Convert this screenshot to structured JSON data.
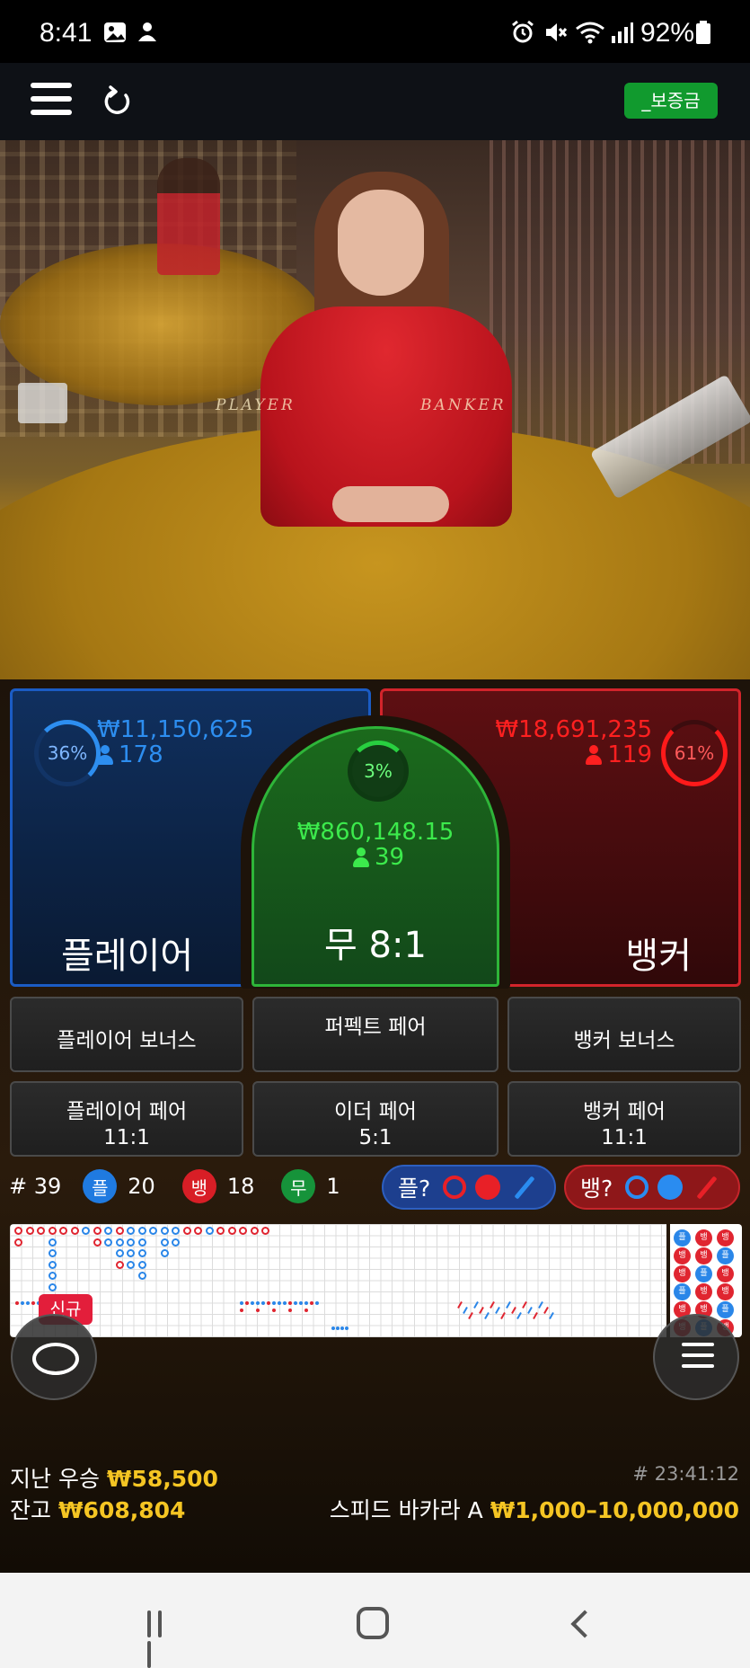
{
  "status_bar": {
    "time": "8:41",
    "battery": "92%",
    "icons": [
      "gallery-icon",
      "notification-icon",
      "alarm-icon",
      "mute-icon",
      "wifi-icon",
      "signal-icon",
      "battery-icon"
    ]
  },
  "app_bar": {
    "bonus_button": "_보증금"
  },
  "video": {
    "table_text_player": "PLAYER",
    "table_text_banker": "BANKER"
  },
  "bets": {
    "player": {
      "percent": "36%",
      "amount": "₩11,150,625",
      "count": "178",
      "label": "플레이어",
      "color": "#2d8ef0"
    },
    "tie": {
      "percent": "3%",
      "amount": "₩860,148.15",
      "count": "39",
      "label": "무 8:1",
      "color": "#28d040"
    },
    "banker": {
      "percent": "61%",
      "amount": "₩18,691,235",
      "count": "119",
      "label": "뱅커",
      "color": "#ff1a1a"
    }
  },
  "side_bets": {
    "player_bonus": "플레이어 보너스",
    "perfect_pair": "퍼펙트 페어",
    "banker_bonus": "뱅커 보너스",
    "player_pair": {
      "label": "플레이어 페어",
      "odds": "11:1"
    },
    "either_pair": {
      "label": "이더 페어",
      "odds": "5:1"
    },
    "banker_pair": {
      "label": "뱅커 페어",
      "odds": "11:1"
    }
  },
  "stats": {
    "round": "# 39",
    "player_badge": "플",
    "player_count": "20",
    "banker_badge": "뱅",
    "banker_count": "18",
    "tie_badge": "무",
    "tie_count": "1"
  },
  "ask": {
    "player": "플?",
    "banker": "뱅?"
  },
  "roadmap": {
    "new_badge": "신규",
    "right_labels": [
      "뱅",
      "플"
    ]
  },
  "footer": {
    "last_win_label": "지난 우승",
    "last_win_amount": "₩58,500",
    "balance_label": "잔고",
    "balance_amount": "₩608,804",
    "round_id": "# 23:41:12",
    "table_name": "스피드 바카라 A",
    "limits": "₩1,000–10,000,000"
  },
  "colors": {
    "player_blue": "#1b5cc4",
    "banker_red": "#d3242b",
    "tie_green": "#2eb539",
    "bonus_green": "#119a2e",
    "gold": "#f5c523"
  }
}
